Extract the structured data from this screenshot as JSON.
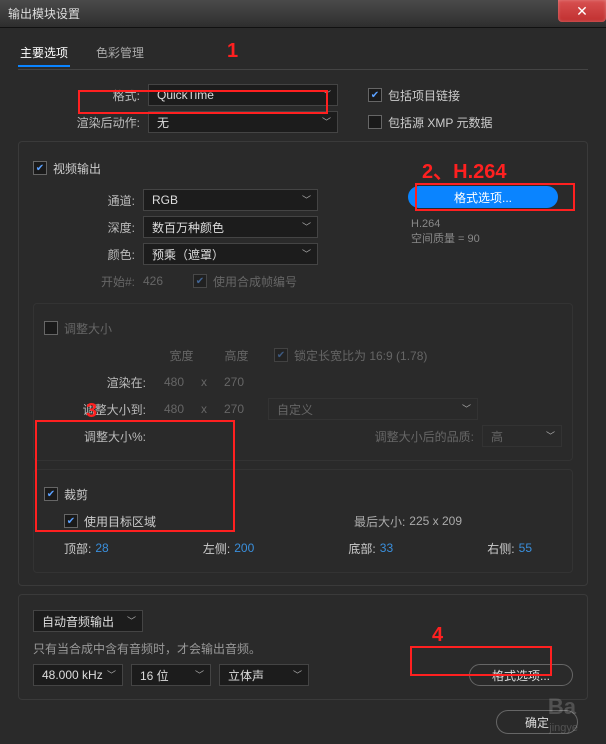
{
  "window": {
    "title": "输出模块设置"
  },
  "tabs": {
    "main": "主要选项",
    "color": "色彩管理"
  },
  "annot": {
    "n1": "1",
    "n2": "2、H.264",
    "n3": "3",
    "n4": "4"
  },
  "format_row": {
    "label": "格式:",
    "value": "QuickTime",
    "include_link": "包括项目链接"
  },
  "postrender_row": {
    "label": "渲染后动作:",
    "value": "无",
    "include_xmp": "包括源 XMP 元数据"
  },
  "video_out": {
    "title": "视频输出",
    "channel_label": "通道:",
    "channel_value": "RGB",
    "depth_label": "深度:",
    "depth_value": "数百万种颜色",
    "color_label": "颜色:",
    "color_value": "预乘（遮罩）",
    "start_label": "开始#:",
    "start_value": "426",
    "use_comp_frame": "使用合成帧编号",
    "format_options_btn": "格式选项...",
    "codec": "H.264",
    "quality": "空间质量 = 90"
  },
  "resize": {
    "title": "调整大小",
    "width": "宽度",
    "height": "高度",
    "lock_ratio": "锁定长宽比为 16:9 (1.78)",
    "render_at": "渲染在:",
    "render_w": "480",
    "render_h": "270",
    "resize_to": "调整大小到:",
    "resize_w": "480",
    "resize_h": "270",
    "custom": "自定义",
    "resize_pct_label": "调整大小%:",
    "quality_label": "调整大小后的品质:",
    "quality_value": "高",
    "x": "x"
  },
  "crop": {
    "title": "裁剪",
    "use_roi": "使用目标区域",
    "final_size_label": "最后大小:",
    "final_size_value": "225 x 209",
    "top_label": "顶部:",
    "top_value": "28",
    "left_label": "左侧:",
    "left_value": "200",
    "bottom_label": "底部:",
    "bottom_value": "33",
    "right_label": "右侧:",
    "right_value": "55"
  },
  "audio": {
    "mode": "自动音频输出",
    "note": "只有当合成中含有音频时，才会输出音频。",
    "rate": "48.000 kHz",
    "bit": "16 位",
    "type": "立体声",
    "format_options_btn": "格式选项..."
  },
  "footer": {
    "ok": "确定"
  },
  "watermark": "Ba"
}
